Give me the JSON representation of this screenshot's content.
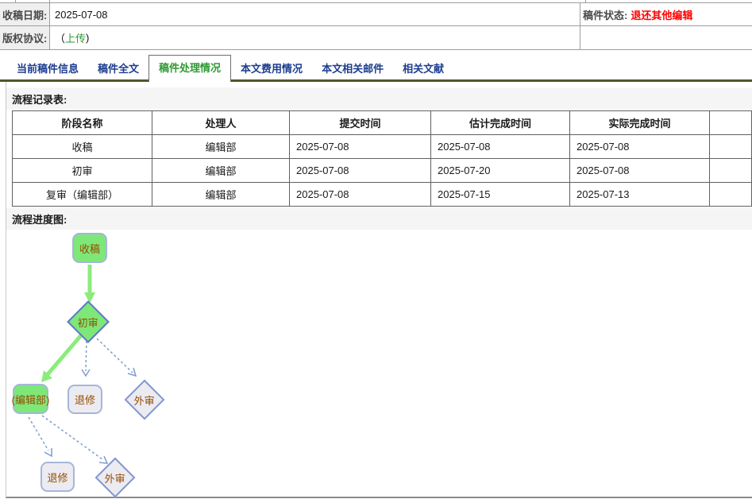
{
  "info": {
    "receive_date_label": "收稿日期:",
    "receive_date": "2025-07-08",
    "copyright_label": "版权协议:",
    "copyright_prefix": "（",
    "copyright_link": "上传",
    "copyright_suffix": ")",
    "status_label": "稿件状态:",
    "status_value": "退还其他编辑"
  },
  "tabs": [
    {
      "label": "当前稿件信息",
      "active": false
    },
    {
      "label": "稿件全文",
      "active": false
    },
    {
      "label": "稿件处理情况",
      "active": true
    },
    {
      "label": "本文费用情况",
      "active": false
    },
    {
      "label": "本文相关邮件",
      "active": false
    },
    {
      "label": "相关文献",
      "active": false
    }
  ],
  "record_table": {
    "section_label": "流程记录表:",
    "headers": [
      "阶段名称",
      "处理人",
      "提交时间",
      "估计完成时间",
      "实际完成时间",
      ""
    ],
    "rows": [
      [
        "收稿",
        "编辑部",
        "2025-07-08",
        "2025-07-08",
        "2025-07-08",
        ""
      ],
      [
        "初审",
        "编辑部",
        "2025-07-08",
        "2025-07-20",
        "2025-07-08",
        ""
      ],
      [
        "复审（编辑部）",
        "编辑部",
        "2025-07-08",
        "2025-07-15",
        "2025-07-13",
        ""
      ]
    ]
  },
  "flow": {
    "section_label": "流程进度图:",
    "nodes": [
      {
        "id": "shougao",
        "label": "收稿",
        "shape": "rounded-rect",
        "state": "completed"
      },
      {
        "id": "chushen",
        "label": "初审",
        "shape": "diamond",
        "state": "completed"
      },
      {
        "id": "fushen-bianjibu",
        "label": "(编辑部)",
        "shape": "rounded-rect",
        "state": "completed"
      },
      {
        "id": "tuixiu-1",
        "label": "退修",
        "shape": "rounded-rect",
        "state": "inactive"
      },
      {
        "id": "waishen-1",
        "label": "外审",
        "shape": "diamond",
        "state": "inactive"
      },
      {
        "id": "tuixiu-2",
        "label": "退修",
        "shape": "rounded-rect",
        "state": "inactive"
      },
      {
        "id": "waishen-2",
        "label": "外审",
        "shape": "diamond",
        "state": "inactive"
      }
    ]
  },
  "colors": {
    "status_red": "#ff0000",
    "link_green": "#2f9931",
    "tab_inactive_blue": "#1d3d8f",
    "tab_active_green": "#2f9931",
    "tab_rule_olive": "#4b5829",
    "node_active_fill": "#7de878",
    "node_inactive_fill": "#ebebf1",
    "node_rect_border": "#a6b6da",
    "node_diamond_border": "#6276cc",
    "node_text_brown": "#964b00",
    "solid_arrow_green": "#8bec7c",
    "dashed_arrow_blue": "#7e9ccc"
  }
}
